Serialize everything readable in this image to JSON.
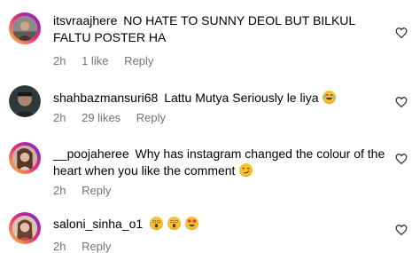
{
  "comments": [
    {
      "username": "itsvraajhere",
      "text": "NO HATE TO SUNNY DEOL BUT BILKUL FALTU POSTER HA",
      "time": "2h",
      "likes": "1 like",
      "reply": "Reply",
      "avatar_icon": "profile-photo"
    },
    {
      "username": "shahbazmansuri68",
      "text": "Lattu Mutya Seriously le liya",
      "time": "2h",
      "likes": "29 likes",
      "reply": "Reply",
      "emojis": [
        "laughing-emoji"
      ],
      "avatar_icon": "profile-photo"
    },
    {
      "username": "__poojaheree",
      "text": "Why has instagram changed the colour of the heart when you like the comment",
      "time": "2h",
      "reply": "Reply",
      "emojis": [
        "smirk-emoji"
      ],
      "avatar_icon": "profile-photo"
    },
    {
      "username": "saloni_sinha_o1",
      "text": "",
      "time": "2h",
      "reply": "Reply",
      "emojis": [
        "astonished-emoji",
        "astonished-emoji",
        "heart-eyes-emoji"
      ],
      "avatar_icon": "profile-photo"
    }
  ],
  "icons": {
    "like": "heart-outline-icon"
  },
  "colors": {
    "text": "#000000",
    "meta": "#737373",
    "story_ring_start": "#f9ce34",
    "story_ring_mid": "#ee2a7b",
    "story_ring_end": "#6228d7"
  }
}
